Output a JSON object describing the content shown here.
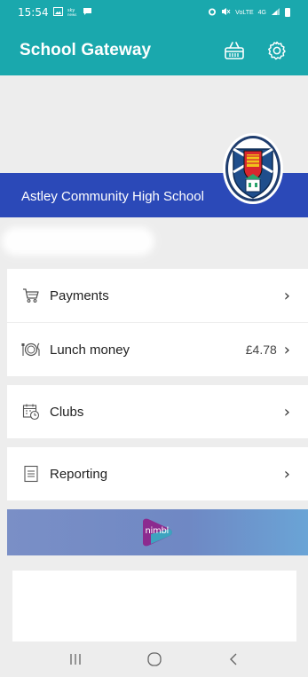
{
  "status_bar": {
    "time": "15:54",
    "net_label": "4G",
    "volte_label": "VoLTE",
    "icons": [
      "gallery-icon",
      "sky-news-icon",
      "chat-icon",
      "alarm-icon",
      "mute-icon",
      "volte-icon",
      "signal-icon",
      "battery-icon"
    ]
  },
  "app_bar": {
    "title": "School Gateway",
    "actions": [
      "basket-icon",
      "settings-icon"
    ]
  },
  "school": {
    "name": "Astley Community High School"
  },
  "menu": [
    {
      "id": "payments",
      "label": "Payments",
      "value": "",
      "icon": "cart-icon"
    },
    {
      "id": "lunch-money",
      "label": "Lunch money",
      "value": "£4.78",
      "icon": "plate-cutlery-icon"
    },
    {
      "id": "clubs",
      "label": "Clubs",
      "value": "",
      "icon": "calendar-clock-icon"
    },
    {
      "id": "reporting",
      "label": "Reporting",
      "value": "",
      "icon": "document-icon"
    }
  ],
  "banner": {
    "logo_text": "nimbl"
  },
  "colors": {
    "teal": "#1aa8ad",
    "blue_band": "#2b49b8",
    "background": "#ededed"
  },
  "nav_bar": {
    "buttons": [
      "recent-apps-icon",
      "home-icon",
      "back-icon"
    ]
  }
}
